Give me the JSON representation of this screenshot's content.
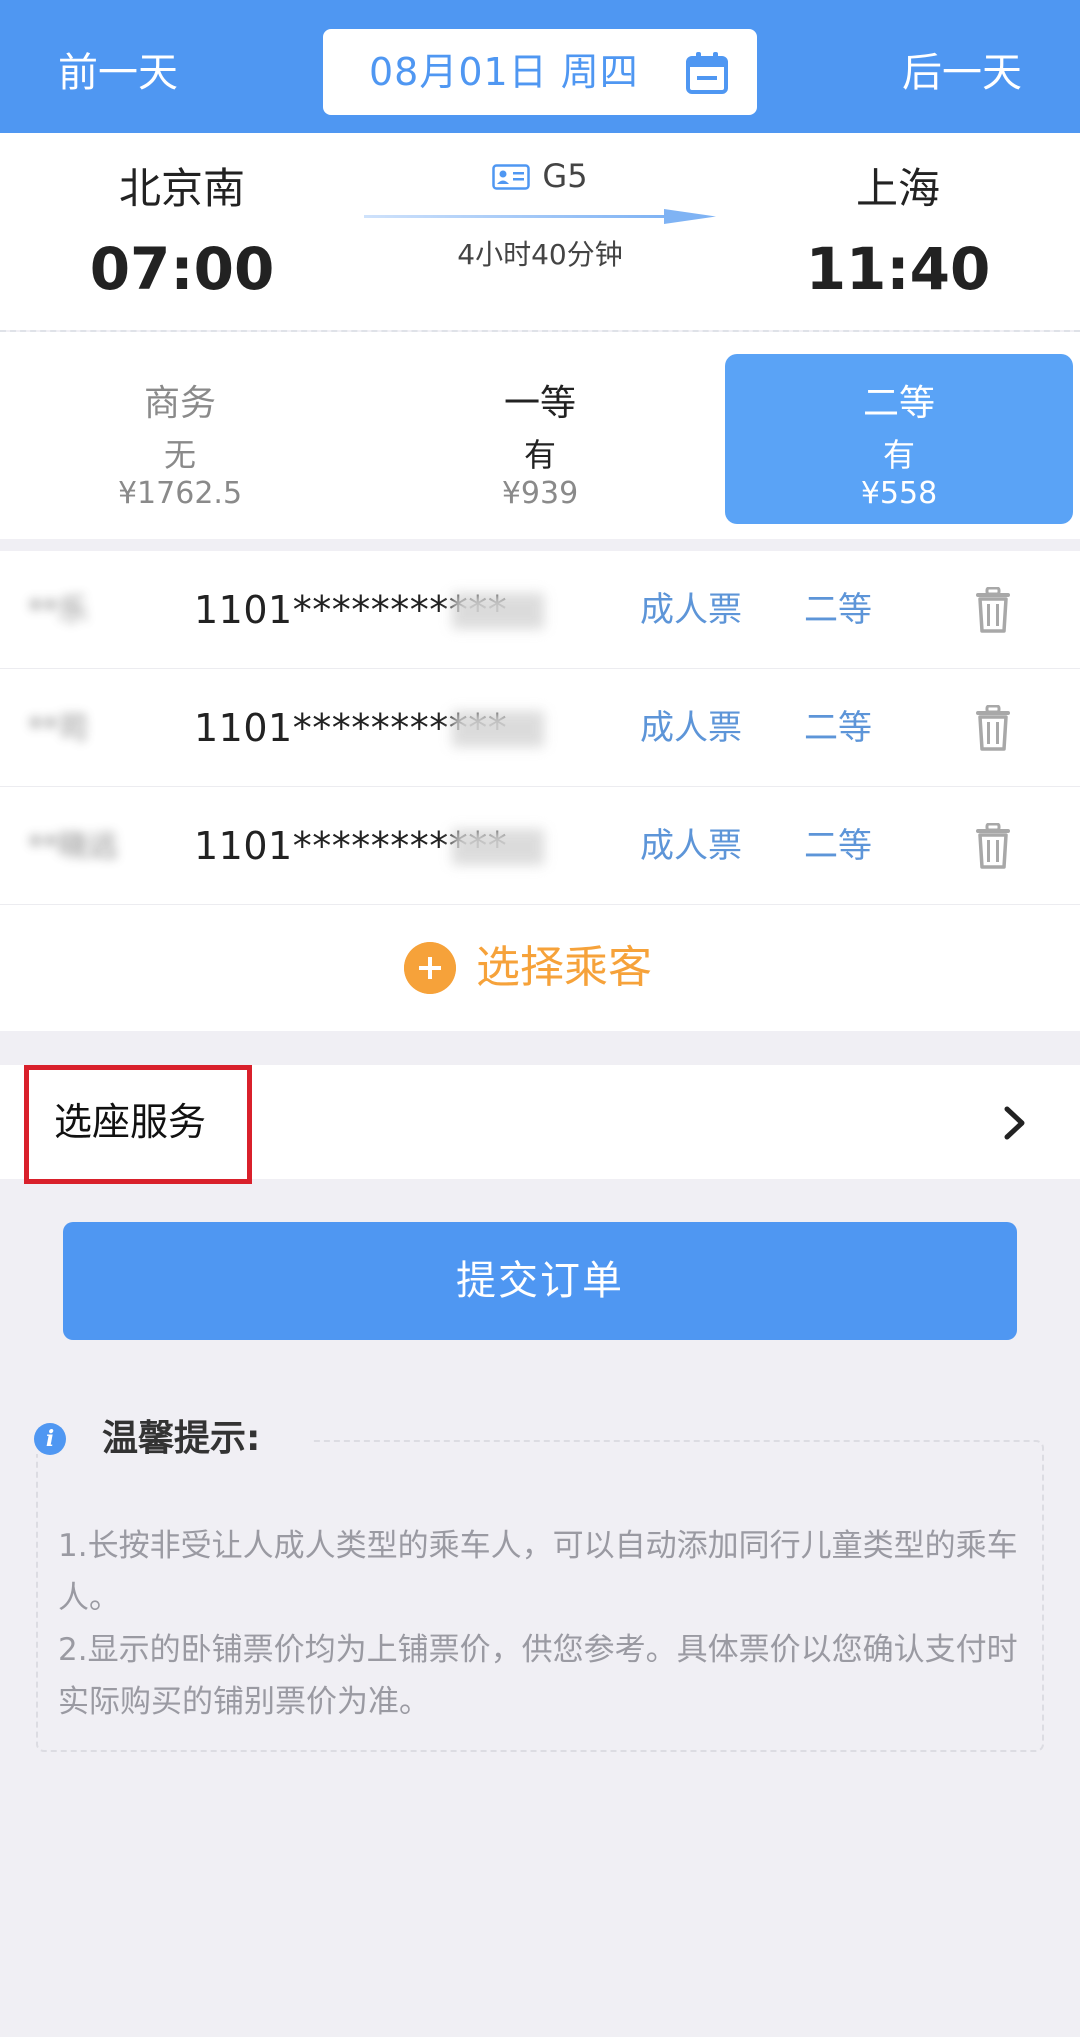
{
  "colors": {
    "primary": "#4f97f2",
    "accent_orange": "#f6a23a",
    "highlight_red": "#d9202b",
    "link_blue": "#5d95d8"
  },
  "header": {
    "prev_label": "前一天",
    "next_label": "后一天",
    "date_label": "08月01日 周四",
    "calendar_icon": "calendar-icon"
  },
  "train": {
    "from_station": "北京南",
    "to_station": "上海",
    "depart_time": "07:00",
    "arrive_time": "11:40",
    "train_no": "G5",
    "duration": "4小时40分钟"
  },
  "seats": [
    {
      "name": "商务",
      "availability": "无",
      "price": "¥1762.5"
    },
    {
      "name": "一等",
      "availability": "有",
      "price": "¥939"
    },
    {
      "name": "二等",
      "availability": "有",
      "price": "¥558",
      "selected": true
    }
  ],
  "passengers": [
    {
      "name": "**乐",
      "id": "1101***********",
      "ticket_type": "成人票",
      "seat_class": "二等"
    },
    {
      "name": "**司",
      "id": "1101***********",
      "ticket_type": "成人票",
      "seat_class": "二等"
    },
    {
      "name": "**晓远",
      "id": "1101***********",
      "ticket_type": "成人票",
      "seat_class": "二等"
    }
  ],
  "add_passenger": {
    "label": "选择乘客"
  },
  "seat_service": {
    "label": "选座服务"
  },
  "submit": {
    "label": "提交订单"
  },
  "tips": {
    "title": "温馨提示:",
    "lines": [
      "1.长按非受让人成人类型的乘车人，可以自动添加同行儿童类型的乘车人。",
      "2.显示的卧铺票价均为上铺票价，供您参考。具体票价以您确认支付时实际购买的铺别票价为准。"
    ]
  }
}
